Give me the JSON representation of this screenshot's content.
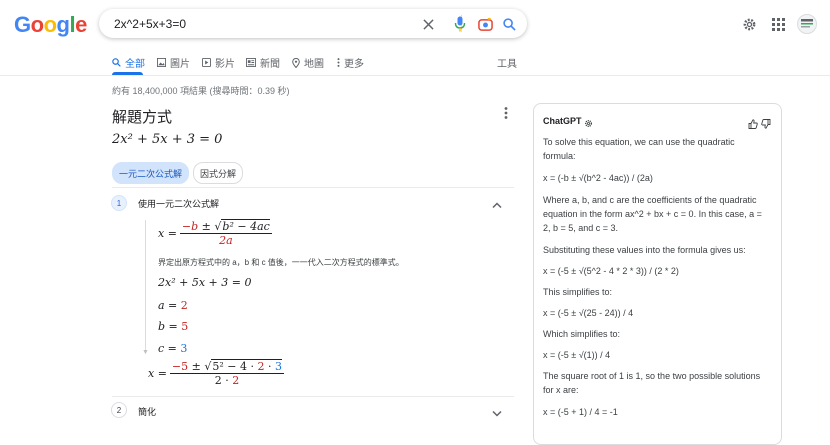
{
  "header": {
    "logo_letters": [
      {
        "ch": "G",
        "color": "#4285f4"
      },
      {
        "ch": "o",
        "color": "#ea4335"
      },
      {
        "ch": "o",
        "color": "#fbbc05"
      },
      {
        "ch": "g",
        "color": "#4285f4"
      },
      {
        "ch": "l",
        "color": "#34a853"
      },
      {
        "ch": "e",
        "color": "#ea4335"
      }
    ],
    "query": "2x^2+5x+3=0",
    "icons": [
      "clear-icon",
      "microphone-icon",
      "camera-lens-icon",
      "search-icon",
      "settings-gear-icon",
      "apps-grid-icon",
      "account-avatar"
    ]
  },
  "tabs": [
    {
      "label": "全部",
      "icon": "search-icon",
      "active": true
    },
    {
      "label": "圖片",
      "icon": "image-icon"
    },
    {
      "label": "影片",
      "icon": "video-icon"
    },
    {
      "label": "新聞",
      "icon": "news-icon"
    },
    {
      "label": "地圖",
      "icon": "map-pin-icon"
    },
    {
      "label": "更多",
      "icon": "more-vert-icon"
    }
  ],
  "tools_label": "工具",
  "result_stats": "約有 18,400,000 項結果 (搜尋時間：0.39 秒)",
  "solver": {
    "title": "解題方式",
    "equation": "2x² + 5x + 3 = 0",
    "chips": [
      "一元二次公式解",
      "因式分解"
    ],
    "step1": {
      "number": "1",
      "label": "使用一元二次公式解",
      "formula_lhs": "x =",
      "formula_num_a": "−b",
      "formula_num_pm": " ± ",
      "formula_num_sqrt": "b² − 4ac",
      "formula_den": "2a",
      "description": "界定出原方程式中的 a，b 和 c 值後，一一代入二次方程式的標準式。",
      "equation": "2x² + 5x + 3 = 0",
      "a_label": "a =",
      "a_val": "2",
      "b_label": "b =",
      "b_val": "5",
      "c_label": "c =",
      "c_val": "3",
      "sub_lhs": "x =",
      "sub_num_a": "−5",
      "sub_num_pm": " ± ",
      "sub_sqrt_a": "5² − 4 · ",
      "sub_sqrt_b": "2",
      "sub_sqrt_c": " · ",
      "sub_sqrt_d": "3",
      "sub_den_a": "2 · ",
      "sub_den_b": "2"
    },
    "step2": {
      "number": "2",
      "label": "簡化"
    }
  },
  "chatgpt": {
    "title": "ChatGPT",
    "paragraphs": [
      "To solve this equation, we can use the quadratic formula:",
      "x = (-b ± √(b^2 - 4ac)) / (2a)",
      "Where a, b, and c are the coefficients of the quadratic equation in the form ax^2 + bx + c = 0. In this case, a = 2, b = 5, and c = 3.",
      "Substituting these values into the formula gives us:",
      "x = (-5 ± √(5^2 - 4 * 2 * 3)) / (2 * 2)",
      "This simplifies to:",
      "x = (-5 ± √(25 - 24)) / 4",
      "Which simplifies to:",
      "x = (-5 ± √(1)) / 4",
      "The square root of 1 is 1, so the two possible solutions for x are:",
      "x = (-5 + 1) / 4 = -1"
    ]
  },
  "colors": {
    "accent": "#1a73e8",
    "highlight": "#c5221f"
  }
}
